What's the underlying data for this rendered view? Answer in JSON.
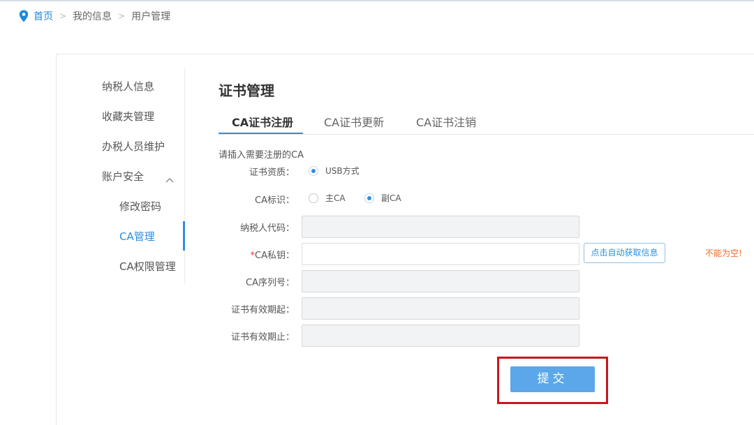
{
  "breadcrumb": {
    "items": [
      "首页",
      "我的信息",
      "用户管理"
    ],
    "separator": ">"
  },
  "sidebar": {
    "items": [
      {
        "label": "纳税人信息"
      },
      {
        "label": "收藏夹管理"
      },
      {
        "label": "办税人员维护"
      },
      {
        "label": "账户安全",
        "expanded": true
      },
      {
        "label": "修改密码",
        "sub": true
      },
      {
        "label": "CA管理",
        "sub": true,
        "active": true
      },
      {
        "label": "CA权限管理",
        "sub": true
      }
    ]
  },
  "page": {
    "title": "证书管理",
    "tabs": [
      "CA证书注册",
      "CA证书更新",
      "CA证书注销"
    ],
    "active_tab": 0,
    "hint": "请插入需要注册的CA"
  },
  "form": {
    "cert_type": {
      "label": "证书资质：",
      "option": "USB方式",
      "selected": true
    },
    "ca_flag": {
      "label": "CA标识：",
      "options": [
        "主CA",
        "副CA"
      ],
      "selected": "副CA"
    },
    "taxpayer_code": {
      "label": "纳税人代码：",
      "value": ""
    },
    "ca_key": {
      "required_mark": "*",
      "label": "CA私钥：",
      "value": ""
    },
    "ca_serial": {
      "label": "CA序列号：",
      "value": ""
    },
    "valid_from": {
      "label": "证书有效期起：",
      "value": ""
    },
    "valid_to": {
      "label": "证书有效期止：",
      "value": ""
    },
    "fetch_button": "点击自动获取信息",
    "error_message": "不能为空!",
    "submit_button": "提交"
  },
  "colors": {
    "accent": "#2e8fe0",
    "submit": "#5ba7ea",
    "error": "#f26a2b",
    "highlight": "#c8161d"
  }
}
